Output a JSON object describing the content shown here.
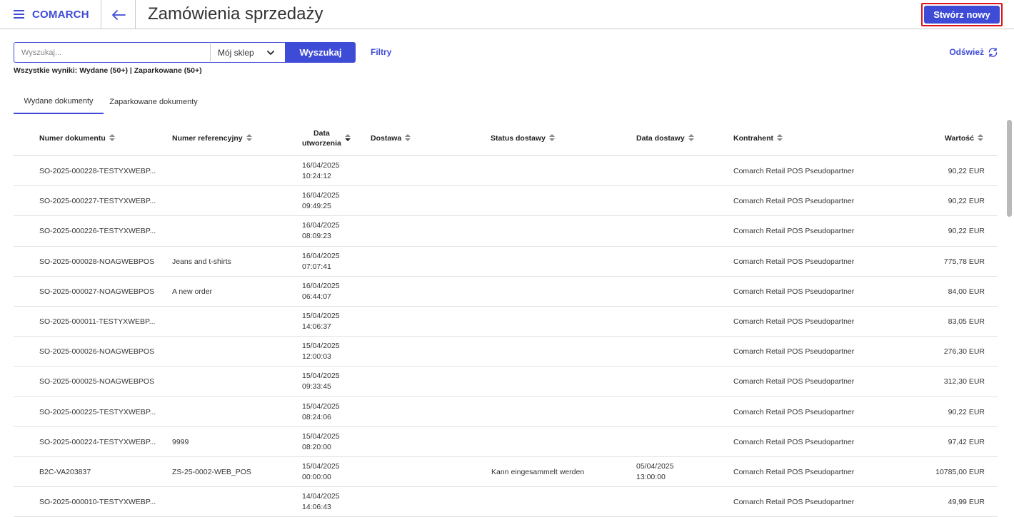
{
  "app": {
    "logo": "COMARCH",
    "title": "Zamówienia sprzedaży",
    "create_label": "Stwórz nowy"
  },
  "icons": {
    "menu": "hamburger-icon",
    "back": "arrow-left-icon",
    "dropdown": "chevron-down-icon",
    "refresh": "refresh-icon"
  },
  "search": {
    "placeholder": "Wyszukaj...",
    "value": "",
    "store_selected": "Mój sklep",
    "button_label": "Wyszukaj"
  },
  "filters_label": "Filtry",
  "refresh_label": "Odśwież",
  "results_summary": "Wszystkie wyniki: Wydane (50+) | Zaparkowane (50+)",
  "tabs": [
    {
      "label": "Wydane dokumenty",
      "active": true
    },
    {
      "label": "Zaparkowane dokumenty",
      "active": false
    }
  ],
  "columns": {
    "document_number": "Numer dokumentu",
    "reference_number": "Numer referencyjny",
    "created_date_line1": "Data",
    "created_date_line2": "utworzenia",
    "delivery": "Dostawa",
    "delivery_status": "Status dostawy",
    "delivery_date": "Data dostawy",
    "contractor": "Kontrahent",
    "value": "Wartość"
  },
  "rows": [
    {
      "doc": "SO-2025-000228-TESTYXWEBP...",
      "ref": "",
      "date": "16/04/2025",
      "time": "10:24:12",
      "delivery": "",
      "status": "",
      "ddate": "",
      "dtime": "",
      "contractor": "Comarch Retail POS Pseudopartner",
      "value": "90,22 EUR"
    },
    {
      "doc": "SO-2025-000227-TESTYXWEBP...",
      "ref": "",
      "date": "16/04/2025",
      "time": "09:49:25",
      "delivery": "",
      "status": "",
      "ddate": "",
      "dtime": "",
      "contractor": "Comarch Retail POS Pseudopartner",
      "value": "90,22 EUR"
    },
    {
      "doc": "SO-2025-000226-TESTYXWEBP...",
      "ref": "",
      "date": "16/04/2025",
      "time": "08:09:23",
      "delivery": "",
      "status": "",
      "ddate": "",
      "dtime": "",
      "contractor": "Comarch Retail POS Pseudopartner",
      "value": "90,22 EUR"
    },
    {
      "doc": "SO-2025-000028-NOAGWEBPOS",
      "ref": "Jeans and t-shirts",
      "date": "16/04/2025",
      "time": "07:07:41",
      "delivery": "",
      "status": "",
      "ddate": "",
      "dtime": "",
      "contractor": "Comarch Retail POS Pseudopartner",
      "value": "775,78 EUR"
    },
    {
      "doc": "SO-2025-000027-NOAGWEBPOS",
      "ref": "A new order",
      "date": "16/04/2025",
      "time": "06:44:07",
      "delivery": "",
      "status": "",
      "ddate": "",
      "dtime": "",
      "contractor": "Comarch Retail POS Pseudopartner",
      "value": "84,00 EUR"
    },
    {
      "doc": "SO-2025-000011-TESTYXWEBP...",
      "ref": "",
      "date": "15/04/2025",
      "time": "14:06:37",
      "delivery": "",
      "status": "",
      "ddate": "",
      "dtime": "",
      "contractor": "Comarch Retail POS Pseudopartner",
      "value": "83,05 EUR"
    },
    {
      "doc": "SO-2025-000026-NOAGWEBPOS",
      "ref": "",
      "date": "15/04/2025",
      "time": "12:00:03",
      "delivery": "",
      "status": "",
      "ddate": "",
      "dtime": "",
      "contractor": "Comarch Retail POS Pseudopartner",
      "value": "276,30 EUR"
    },
    {
      "doc": "SO-2025-000025-NOAGWEBPOS",
      "ref": "",
      "date": "15/04/2025",
      "time": "09:33:45",
      "delivery": "",
      "status": "",
      "ddate": "",
      "dtime": "",
      "contractor": "Comarch Retail POS Pseudopartner",
      "value": "312,30 EUR"
    },
    {
      "doc": "SO-2025-000225-TESTYXWEBP...",
      "ref": "",
      "date": "15/04/2025",
      "time": "08:24:06",
      "delivery": "",
      "status": "",
      "ddate": "",
      "dtime": "",
      "contractor": "Comarch Retail POS Pseudopartner",
      "value": "90,22 EUR"
    },
    {
      "doc": "SO-2025-000224-TESTYXWEBP...",
      "ref": "9999",
      "date": "15/04/2025",
      "time": "08:20:00",
      "delivery": "",
      "status": "",
      "ddate": "",
      "dtime": "",
      "contractor": "Comarch Retail POS Pseudopartner",
      "value": "97,42 EUR"
    },
    {
      "doc": "B2C-VA203837",
      "ref": "ZS-25-0002-WEB_POS",
      "date": "15/04/2025",
      "time": "00:00:00",
      "delivery": "",
      "status": "Kann eingesammelt werden",
      "ddate": "05/04/2025",
      "dtime": "13:00:00",
      "contractor": "Comarch Retail POS Pseudopartner",
      "value": "10785,00 EUR"
    },
    {
      "doc": "SO-2025-000010-TESTYXWEBP...",
      "ref": "",
      "date": "14/04/2025",
      "time": "14:06:43",
      "delivery": "",
      "status": "",
      "ddate": "",
      "dtime": "",
      "contractor": "Comarch Retail POS Pseudopartner",
      "value": "49,99 EUR"
    }
  ]
}
